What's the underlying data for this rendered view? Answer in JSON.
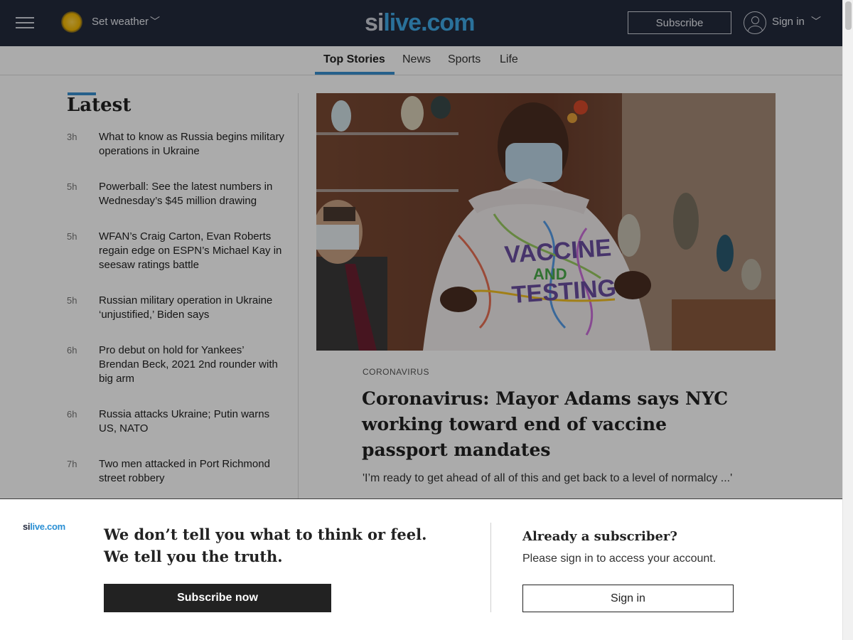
{
  "header": {
    "weather_label": "Set weather",
    "logo_si": "si",
    "logo_live": "live.com",
    "subscribe_label": "Subscribe",
    "signin_label": "Sign in"
  },
  "section_nav": {
    "items": [
      {
        "label": "Top Stories",
        "active": true
      },
      {
        "label": "News",
        "active": false
      },
      {
        "label": "Sports",
        "active": false
      },
      {
        "label": "Life",
        "active": false
      }
    ]
  },
  "latest": {
    "title": "Latest",
    "items": [
      {
        "time": "3h",
        "headline": "What to know as Russia begins military operations in Ukraine"
      },
      {
        "time": "5h",
        "headline": "Powerball: See the latest numbers in Wednesday’s $45 million drawing"
      },
      {
        "time": "5h",
        "headline": "WFAN’s Craig Carton, Evan Roberts regain edge on ESPN’s Michael Kay in seesaw ratings battle"
      },
      {
        "time": "5h",
        "headline": "Russian military operation in Ukraine ‘unjustified,’ Biden says"
      },
      {
        "time": "6h",
        "headline": "Pro debut on hold for Yankees’ Brendan Beck, 2021 2nd rounder with big arm"
      },
      {
        "time": "6h",
        "headline": "Russia attacks Ukraine; Putin warns US, NATO"
      },
      {
        "time": "7h",
        "headline": "Two men attacked in Port Richmond street robbery"
      }
    ]
  },
  "hero": {
    "kicker": "CORONAVIRUS",
    "headline": "Coronavirus: Mayor Adams says NYC working toward end of vaccine passport mandates",
    "dek": "'I’m ready to get ahead of all of this and get back to a level of normalcy ...'",
    "image_text_line1": "VACCINE",
    "image_text_line2": "AND",
    "image_text_line3": "TESTING"
  },
  "paywall": {
    "logo_si": "si",
    "logo_live": "live.com",
    "headline_line1": "We don’t tell you what to think or feel.",
    "headline_line2": "We tell you the truth.",
    "subscribe_button": "Subscribe now",
    "already_title": "Already a subscriber?",
    "already_text": "Please sign in to access your account.",
    "signin_button": "Sign in"
  },
  "colors": {
    "header_bg": "#232a3d",
    "accent_blue": "#3a8fd0",
    "logo_blue": "#3fa9e6"
  }
}
